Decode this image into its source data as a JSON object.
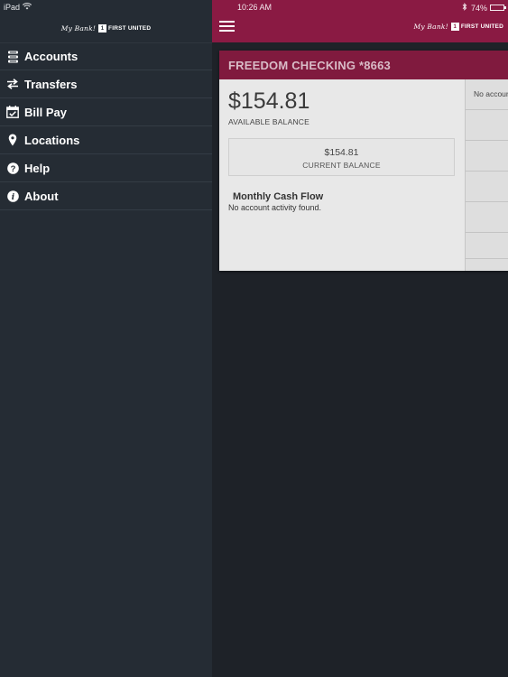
{
  "device": {
    "carrier": "iPad",
    "time": "10:26 AM",
    "battery": "74%",
    "battery_level": 0.74
  },
  "brand": {
    "script": "My Bank!",
    "mark": "1",
    "name": "FIRST UNITED"
  },
  "menu": {
    "items": [
      {
        "label": "Accounts",
        "icon": "accounts-icon"
      },
      {
        "label": "Transfers",
        "icon": "transfers-icon"
      },
      {
        "label": "Bill Pay",
        "icon": "bill-pay-icon"
      },
      {
        "label": "Locations",
        "icon": "location-pin-icon"
      },
      {
        "label": "Help",
        "icon": "help-icon"
      },
      {
        "label": "About",
        "icon": "info-icon"
      }
    ]
  },
  "account": {
    "title": "FREEDOM CHECKING *8663",
    "available_amount": "$154.81",
    "available_label": "AVAILABLE BALANCE",
    "current_amount": "$154.81",
    "current_label": "CURRENT BALANCE",
    "cashflow_title": "Monthly Cash Flow",
    "cashflow_empty": "No account activity found.",
    "side_text": "No account activity found."
  },
  "colors": {
    "accent": "#8a1a43",
    "drawer": "#252c34",
    "card_header": "#801a3e"
  }
}
